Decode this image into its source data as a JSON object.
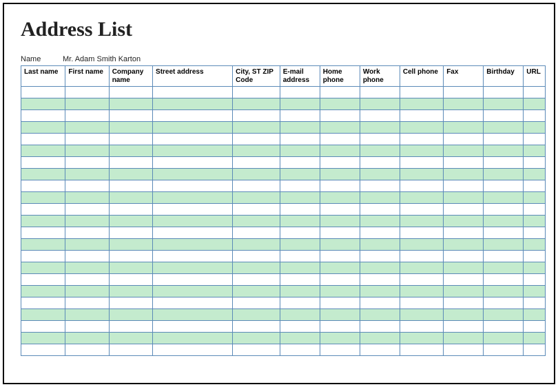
{
  "title": "Address List",
  "name_field": {
    "label": "Name",
    "value": "Mr. Adam Smith Karton"
  },
  "table": {
    "headers": [
      "Last name",
      "First name",
      "Company name",
      "Street address",
      "City, ST  ZIP Code",
      "E-mail address",
      "Home phone",
      "Work phone",
      "Cell phone",
      "Fax",
      "Birthday",
      "URL"
    ],
    "row_count": 23
  },
  "colors": {
    "border": "#5b8ab8",
    "row_odd": "#c4ebce",
    "row_even": "#ffffff"
  }
}
